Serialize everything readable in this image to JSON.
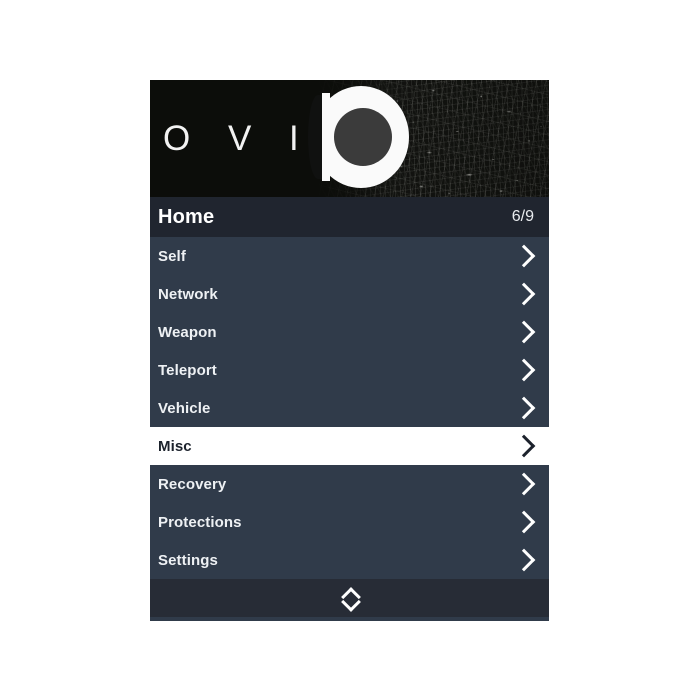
{
  "panel": {
    "banner": {
      "brand_text": "O V I X",
      "logo_icon": "ovix-logo-icon",
      "texture": "grunge-texture"
    },
    "titlebar": {
      "title": "Home",
      "counter": "6/9"
    },
    "menu_items": [
      {
        "label": "Self",
        "chevron": "chevron-right-icon",
        "selected": false
      },
      {
        "label": "Network",
        "chevron": "chevron-right-icon",
        "selected": false
      },
      {
        "label": "Weapon",
        "chevron": "chevron-right-icon",
        "selected": false
      },
      {
        "label": "Teleport",
        "chevron": "chevron-right-icon",
        "selected": false
      },
      {
        "label": "Vehicle",
        "chevron": "chevron-right-icon",
        "selected": false
      },
      {
        "label": "Misc",
        "chevron": "chevron-right-icon",
        "selected": true
      },
      {
        "label": "Recovery",
        "chevron": "chevron-right-icon",
        "selected": false
      },
      {
        "label": "Protections",
        "chevron": "chevron-right-icon",
        "selected": false
      },
      {
        "label": "Settings",
        "chevron": "chevron-right-icon",
        "selected": false
      }
    ],
    "footer": {
      "scroll_icon": "up-down-chevron-icon"
    }
  },
  "colors": {
    "panel_background": "#303b4a",
    "titlebar_background": "#20252f",
    "banner_background": "#0e0f0c",
    "selected_row_background": "#ffffff",
    "selected_row_text": "#1c222c",
    "row_text": "#eef1f4",
    "footer_background": "#272c36",
    "page_background": "#ffffff"
  }
}
